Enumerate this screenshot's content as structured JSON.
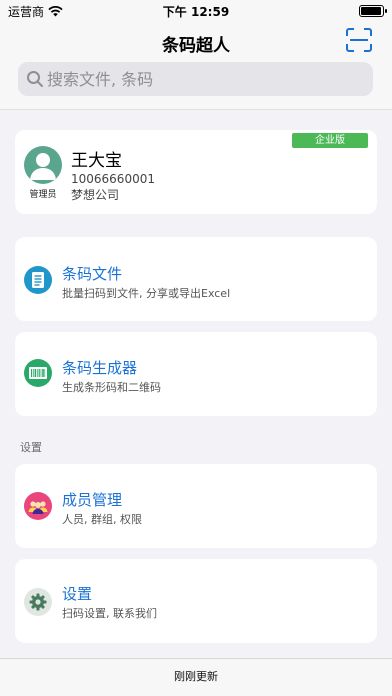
{
  "status_bar": {
    "carrier": "运营商",
    "time": "下午 12:59"
  },
  "nav": {
    "title": "条码超人",
    "scan_icon": "scan-icon"
  },
  "search": {
    "placeholder": "搜索文件, 条码"
  },
  "profile": {
    "name": "王大宝",
    "phone": "10066660001",
    "company": "梦想公司",
    "role": "管理员",
    "badge": "企业版",
    "badge_color": "#4cb856"
  },
  "menu": {
    "files": {
      "label": "条码文件",
      "sub": "批量扫码到文件, 分享或导出Excel",
      "icon": "document-icon"
    },
    "generator": {
      "label": "条码生成器",
      "sub": "生成条形码和二维码",
      "icon": "barcode-icon"
    },
    "section_title": "设置",
    "members": {
      "label": "成员管理",
      "sub": "人员, 群组, 权限",
      "icon": "group-icon"
    },
    "settings": {
      "label": "设置",
      "sub": "扫码设置, 联系我们",
      "icon": "gear-icon"
    }
  },
  "footer": {
    "status": "刚刚更新"
  },
  "colors": {
    "accent": "#1a73d4",
    "background": "#f2f2f7"
  }
}
